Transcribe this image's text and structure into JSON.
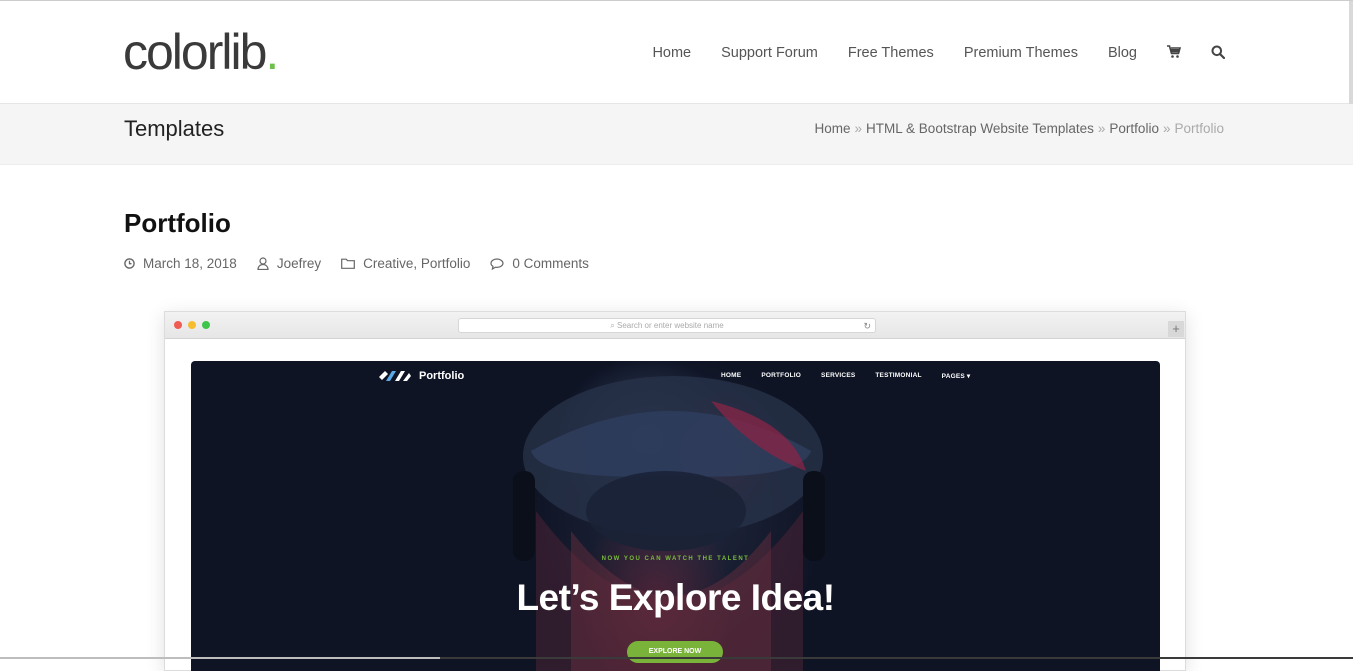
{
  "header": {
    "logo_text": "colorlib",
    "logo_dot": ".",
    "nav": [
      "Home",
      "Support Forum",
      "Free Themes",
      "Premium Themes",
      "Blog"
    ],
    "icons": [
      "cart-icon",
      "search-icon"
    ]
  },
  "band": {
    "title": "Templates",
    "breadcrumb": [
      "Home",
      "HTML & Bootstrap Website Templates",
      "Portfolio"
    ],
    "breadcrumb_current": "Portfolio",
    "separator": "»"
  },
  "post": {
    "title": "Portfolio",
    "date": "March 18, 2018",
    "author": "Joefrey",
    "categories": "Creative, Portfolio",
    "comments": "0 Comments"
  },
  "preview": {
    "url_placeholder": "Search or enter website name",
    "site_logo": "Portfolio",
    "site_nav": [
      "HOME",
      "PORTFOLIO",
      "SERVICES",
      "TESTIMONIAL",
      "PAGES ▾"
    ],
    "eyebrow": "NOW YOU CAN WATCH THE TALENT",
    "headline": "Let’s Explore Idea!",
    "cta": "EXPLORE NOW"
  },
  "colors": {
    "accent_green": "#6dc14b",
    "cta_green": "#7ab33a",
    "hero_bg": "#0e1424"
  }
}
